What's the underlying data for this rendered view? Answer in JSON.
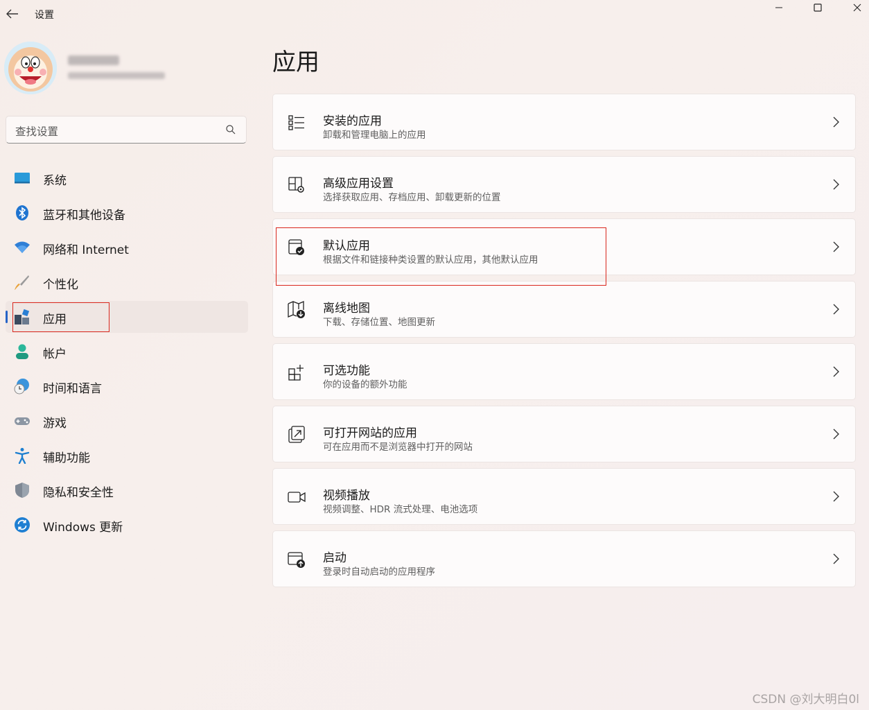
{
  "window": {
    "title": "设置",
    "back": "←",
    "minimize": "—",
    "maximize": "☐",
    "close": "✕"
  },
  "search": {
    "placeholder": "查找设置"
  },
  "sidebar": {
    "items": [
      {
        "label": "系统",
        "icon": "system-icon"
      },
      {
        "label": "蓝牙和其他设备",
        "icon": "bluetooth-icon"
      },
      {
        "label": "网络和 Internet",
        "icon": "wifi-icon"
      },
      {
        "label": "个性化",
        "icon": "brush-icon"
      },
      {
        "label": "应用",
        "icon": "apps-icon",
        "active": true
      },
      {
        "label": "帐户",
        "icon": "account-icon"
      },
      {
        "label": "时间和语言",
        "icon": "time-language-icon"
      },
      {
        "label": "游戏",
        "icon": "gamepad-icon"
      },
      {
        "label": "辅助功能",
        "icon": "accessibility-icon"
      },
      {
        "label": "隐私和安全性",
        "icon": "shield-icon"
      },
      {
        "label": "Windows 更新",
        "icon": "update-icon"
      }
    ]
  },
  "main": {
    "title": "应用",
    "cards": [
      {
        "title": "安装的应用",
        "subtitle": "卸载和管理电脑上的应用",
        "icon": "installed-apps-icon"
      },
      {
        "title": "高级应用设置",
        "subtitle": "选择获取应用、存档应用、卸载更新的位置",
        "icon": "advanced-settings-icon"
      },
      {
        "title": "默认应用",
        "subtitle": "根据文件和链接种类设置的默认应用，其他默认应用",
        "icon": "default-apps-icon"
      },
      {
        "title": "离线地图",
        "subtitle": "下载、存储位置、地图更新",
        "icon": "offline-maps-icon"
      },
      {
        "title": "可选功能",
        "subtitle": "你的设备的额外功能",
        "icon": "optional-features-icon"
      },
      {
        "title": "可打开网站的应用",
        "subtitle": "可在应用而不是浏览器中打开的网站",
        "icon": "apps-for-websites-icon"
      },
      {
        "title": "视频播放",
        "subtitle": "视频调整、HDR 流式处理、电池选项",
        "icon": "video-playback-icon"
      },
      {
        "title": "启动",
        "subtitle": "登录时自动启动的应用程序",
        "icon": "startup-icon"
      }
    ]
  },
  "watermark": "CSDN @刘大明白0l",
  "colors": {
    "accent": "#2563c7",
    "highlight": "#d9261c"
  }
}
